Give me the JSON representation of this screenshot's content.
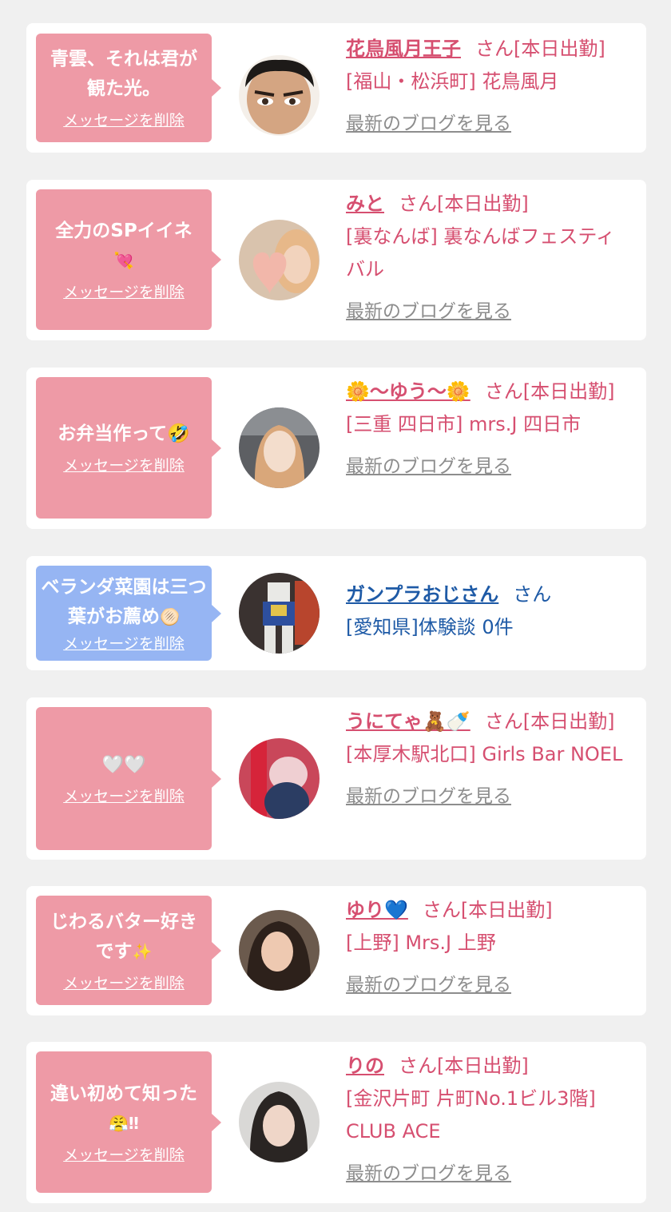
{
  "cards": [
    {
      "message": "青雲、それは君が観た光。",
      "delete_label": "メッセージを削除",
      "name": "花鳥風月王子",
      "san_status": "さん[本日出勤]",
      "location": "[福山・松浜町] 花鳥風月",
      "blog_link": "最新のブログを見る"
    },
    {
      "message": "全力のSPイイネ",
      "message_emoji": "💘",
      "delete_label": "メッセージを削除",
      "name": "みと",
      "san_status": "さん[本日出勤]",
      "location": "[裏なんば] 裏なんばフェスティバル",
      "blog_link": "最新のブログを見る"
    },
    {
      "message": "お弁当作って🤣",
      "delete_label": "メッセージを削除",
      "name": "🌼〜ゆう〜🌼",
      "san_status": "さん[本日出勤]",
      "location": "[三重 四日市] mrs.J 四日市",
      "blog_link": "最新のブログを見る"
    },
    {
      "message": "ベランダ菜園は三つ葉がお薦め",
      "message_emoji": "🫓",
      "delete_label": "メッセージを削除",
      "name": "ガンプラおじさん",
      "san_status": "さん",
      "location": "[愛知県]体験談 0件"
    },
    {
      "message": "🤍🤍",
      "delete_label": "メッセージを削除",
      "name": "うにてゃ🧸🍼",
      "san_status": "さん[本日出勤]",
      "location": "[本厚木駅北口] Girls Bar NOEL",
      "blog_link": "最新のブログを見る"
    },
    {
      "message": "じわるバター好きです",
      "message_emoji": "✨",
      "delete_label": "メッセージを削除",
      "name": "ゆり💙",
      "san_status": "さん[本日出勤]",
      "location": "[上野] Mrs.J 上野",
      "blog_link": "最新のブログを見る"
    },
    {
      "message": "違い初めて知った",
      "message_emoji": "😤‼",
      "delete_label": "メッセージを削除",
      "name": "りの",
      "san_status": "さん[本日出勤]",
      "location": "[金沢片町 片町No.1ビル3階] CLUB ACE",
      "blog_link": "最新のブログを見る"
    }
  ],
  "colors": {
    "pink_bubble": "#ee9aa6",
    "blue_bubble": "#96b5f3",
    "pink_text": "#d64f70",
    "blue_text": "#1e5aa6",
    "blog_gray": "#8d8d8d"
  },
  "avatars": [
    "avatar-man-face",
    "avatar-heart-woman",
    "avatar-woman-car",
    "avatar-gundam-model",
    "avatar-woman-red",
    "avatar-woman-smile",
    "avatar-woman-portrait"
  ]
}
